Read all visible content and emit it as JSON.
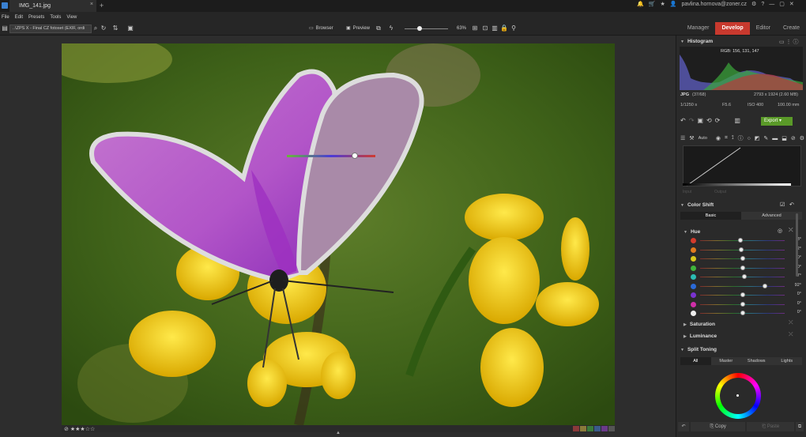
{
  "titlebar": {
    "tab_title": "IMG_141.jpg",
    "close_glyph": "×",
    "new_tab_glyph": "+",
    "user_email": "pavlina.hornova@zoner.cz"
  },
  "menu": [
    "File",
    "Edit",
    "Presets",
    "Tools",
    "View"
  ],
  "toolbar": {
    "path": "..\\ZPS X - Final CZ fotoset (EXIF, ordi",
    "browser_label": "Browser",
    "preview_label": "Preview",
    "zoom": "63%"
  },
  "modes": {
    "manager": "Manager",
    "develop": "Develop",
    "editor": "Editor",
    "create": "Create"
  },
  "histogram": {
    "title": "Histogram",
    "rgb": "RGB: 156, 131, 147",
    "format": "JPG",
    "counter": "(37/68)",
    "dimensions": "2793 x 1924 (2.60 MB)",
    "shutter": "1/1250 s",
    "aperture": "F5.6",
    "iso": "ISO 400",
    "focal": "100.00 mm"
  },
  "actions": {
    "export_label": "Export"
  },
  "curves": {
    "auto_label": "Auto",
    "input_label": "Input",
    "output_label": "Output"
  },
  "colorshift": {
    "title": "Color Shift",
    "tab_basic": "Basic",
    "tab_advanced": "Advanced",
    "hue_title": "Hue",
    "hue_rows": [
      {
        "color": "#d33b2c",
        "value": "-3°",
        "pos": 0.48
      },
      {
        "color": "#e07a1f",
        "value": "-2°",
        "pos": 0.49
      },
      {
        "color": "#d9c81c",
        "value": "0°",
        "pos": 0.5
      },
      {
        "color": "#3fb43c",
        "value": "0°",
        "pos": 0.5
      },
      {
        "color": "#2bbcb4",
        "value": "7°",
        "pos": 0.52
      },
      {
        "color": "#2a6ad8",
        "value": "92°",
        "pos": 0.77
      },
      {
        "color": "#7a33d0",
        "value": "0°",
        "pos": 0.5
      },
      {
        "color": "#cf2fa8",
        "value": "0°",
        "pos": 0.5
      },
      {
        "color": "#eeeeee",
        "value": "0°",
        "pos": 0.5
      }
    ],
    "saturation_label": "Saturation",
    "luminance_label": "Luminance"
  },
  "splittoning": {
    "title": "Split Toning",
    "tabs": [
      "All",
      "Master",
      "Shadows",
      "Lights"
    ]
  },
  "bottom": {
    "copy_label": "Copy",
    "paste_label": "Paste"
  },
  "status": {
    "stars": "★★★☆☆"
  },
  "colors": {
    "accent": "#c8392e",
    "export": "#5a9a28"
  }
}
